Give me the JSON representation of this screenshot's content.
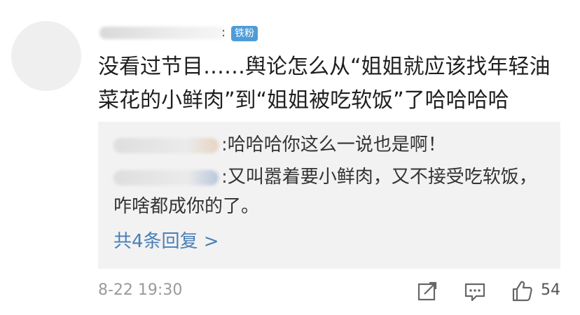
{
  "comment": {
    "badge": "铁粉",
    "separator": ":",
    "text": "没看过节目……舆论怎么从“姐姐就应该找年轻油菜花的小鲜肉”到“姐姐被吃软饭”了哈哈哈哈"
  },
  "replies": [
    {
      "separator": ":",
      "text": "哈哈哈你这么一说也是啊！"
    },
    {
      "separator": ":",
      "text": "又叫嚣着要小鲜肉，又不接受吃软饭，咋啥都成你的了。"
    }
  ],
  "more_replies": "共4条回复 >",
  "footer": {
    "timestamp": "8-22 19:30",
    "like_count": "54"
  },
  "icons": {
    "share": "share-icon",
    "comment": "comment-icon",
    "like": "thumbs-up-icon"
  },
  "colors": {
    "badge": "#4e9bd7",
    "link": "#4a7fb7",
    "reply_bg": "#f2f2f2",
    "muted": "#9a9a9a"
  }
}
